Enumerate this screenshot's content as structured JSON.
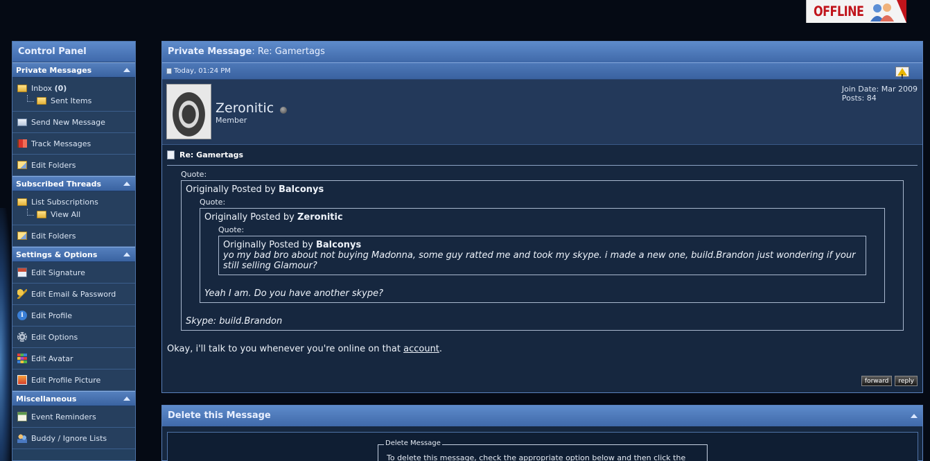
{
  "status_badge": {
    "text": "OFFLINE",
    "color": "#c0141b"
  },
  "sidebar": {
    "title": "Control Panel",
    "sections": [
      {
        "heading": "Private Messages",
        "inbox_label": "Inbox",
        "inbox_count": "(0)",
        "sent_label": "Sent Items",
        "items": [
          {
            "label": "Send New Message",
            "icon": "envelope-icon"
          },
          {
            "label": "Track Messages",
            "icon": "flag-icon"
          },
          {
            "label": "Edit Folders",
            "icon": "edit-folder-icon"
          }
        ]
      },
      {
        "heading": "Subscribed Threads",
        "list_label": "List Subscriptions",
        "viewall_label": "View All",
        "items": [
          {
            "label": "Edit Folders",
            "icon": "edit-folder-icon"
          }
        ]
      },
      {
        "heading": "Settings & Options",
        "items": [
          {
            "label": "Edit Signature",
            "icon": "signature-icon"
          },
          {
            "label": "Edit Email & Password",
            "icon": "key-icon"
          },
          {
            "label": "Edit Profile",
            "icon": "info-icon"
          },
          {
            "label": "Edit Options",
            "icon": "gear-icon"
          },
          {
            "label": "Edit Avatar",
            "icon": "color-grid-icon"
          },
          {
            "label": "Edit Profile Picture",
            "icon": "picture-icon"
          }
        ]
      },
      {
        "heading": "Miscellaneous",
        "items": [
          {
            "label": "Event Reminders",
            "icon": "calendar-icon"
          },
          {
            "label": "Buddy / Ignore Lists",
            "icon": "buddy-icon"
          }
        ]
      }
    ]
  },
  "pm": {
    "title_bold": "Private Message",
    "title_rest": ": Re: Gamertags",
    "timestamp": "Today, 01:24 PM",
    "author": {
      "name": "Zeronitic",
      "title": "Member",
      "join_date": "Join Date: Mar 2009",
      "posts": "Posts: 84"
    },
    "subject": "Re: Gamertags",
    "quote_label": "Quote:",
    "posted_prefix": "Originally Posted by",
    "quote1_author": "Balconys",
    "quote2_author": "Zeronitic",
    "quote3_author": "Balconys",
    "quote3_text": "yo my bad bro about not buying Madonna, some guy ratted me and took my skype. i made a new one, build.Brandon just wondering if your still selling Glamour?",
    "quote2_text": "Yeah I am. Do you have another skype?",
    "quote1_text": "Skype: build.Brandon",
    "reply_text": "Okay, i'll talk to you whenever you're online on that ",
    "reply_link": "account",
    "reply_end": ".",
    "buttons": {
      "forward": "forward",
      "reply": "reply"
    }
  },
  "delete_panel": {
    "title": "Delete this Message",
    "legend": "Delete Message",
    "text": "To delete this message, check the appropriate option below and then click the"
  }
}
